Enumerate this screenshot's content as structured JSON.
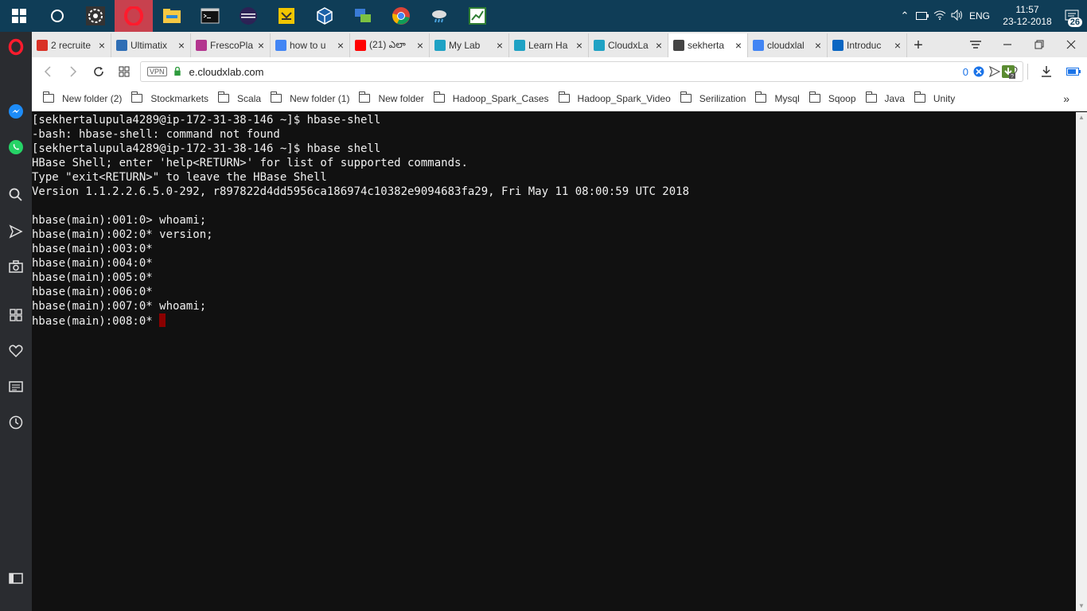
{
  "taskbar": {
    "icons": [
      {
        "name": "windows-start-icon"
      },
      {
        "name": "cortana-search-icon"
      },
      {
        "name": "app-pinwheel-icon"
      },
      {
        "name": "opera-icon"
      },
      {
        "name": "file-explorer-icon"
      },
      {
        "name": "command-prompt-icon"
      },
      {
        "name": "eclipse-icon"
      },
      {
        "name": "network-tool-icon"
      },
      {
        "name": "virtualbox-icon"
      },
      {
        "name": "remote-desktop-icon"
      },
      {
        "name": "chrome-icon"
      },
      {
        "name": "weather-icon"
      },
      {
        "name": "chart-app-icon"
      }
    ],
    "language": "ENG",
    "time": "11:57",
    "date": "23-12-2018",
    "notification_count": "26"
  },
  "tabs": [
    {
      "label": "2 recruite",
      "favicon": "gmail-icon",
      "color": "#d93025",
      "active": false
    },
    {
      "label": "Ultimatix",
      "favicon": "tata-icon",
      "color": "#2f6eb5",
      "active": false
    },
    {
      "label": "FrescoPla",
      "favicon": "fresco-play-icon",
      "color": "#b3358f",
      "active": false
    },
    {
      "label": "how to u",
      "favicon": "google-icon",
      "color": "#4285f4",
      "active": false
    },
    {
      "label": "(21) ఎలా",
      "favicon": "youtube-icon",
      "color": "#ff0000",
      "active": false
    },
    {
      "label": "My Lab",
      "favicon": "cloudxlab-icon",
      "color": "#1fa2c4",
      "active": false
    },
    {
      "label": "Learn Ha",
      "favicon": "cloudxlab-icon",
      "color": "#1fa2c4",
      "active": false
    },
    {
      "label": "CloudxLa",
      "favicon": "cloudxlab-icon",
      "color": "#1fa2c4",
      "active": false
    },
    {
      "label": "sekherta",
      "favicon": "document-icon",
      "color": "#444444",
      "active": true
    },
    {
      "label": "cloudxlal",
      "favicon": "google-icon",
      "color": "#4285f4",
      "active": false
    },
    {
      "label": "Introduc",
      "favicon": "linkedin-icon",
      "color": "#0a66c2",
      "active": false
    }
  ],
  "address": {
    "vpn_label": "VPN",
    "url": "e.cloudxlab.com",
    "blocked_count": "0"
  },
  "bookmarks": [
    "New folder (2)",
    "Stockmarkets",
    "Scala",
    "New folder (1)",
    "New folder",
    "Hadoop_Spark_Cases",
    "Hadoop_Spark_Video",
    "Serilization",
    "Mysql",
    "Sqoop",
    "Java",
    "Unity"
  ],
  "bookmarks_more": "»",
  "terminal": {
    "lines": [
      "[sekhertalupula4289@ip-172-31-38-146 ~]$ hbase-shell",
      "-bash: hbase-shell: command not found",
      "[sekhertalupula4289@ip-172-31-38-146 ~]$ hbase shell",
      "HBase Shell; enter 'help<RETURN>' for list of supported commands.",
      "Type \"exit<RETURN>\" to leave the HBase Shell",
      "Version 1.1.2.2.6.5.0-292, r897822d4dd5956ca186974c10382e9094683fa29, Fri May 11 08:00:59 UTC 2018",
      "",
      "hbase(main):001:0> whoami;",
      "hbase(main):002:0* version;",
      "hbase(main):003:0*",
      "hbase(main):004:0*",
      "hbase(main):005:0*",
      "hbase(main):006:0*",
      "hbase(main):007:0* whoami;"
    ],
    "prompt": "hbase(main):008:0* "
  },
  "colors": {
    "taskbar_bg": "#0f3d57",
    "opera_red": "#c8414e",
    "terminal_bg": "#111111",
    "cursor": "#8b0000"
  }
}
